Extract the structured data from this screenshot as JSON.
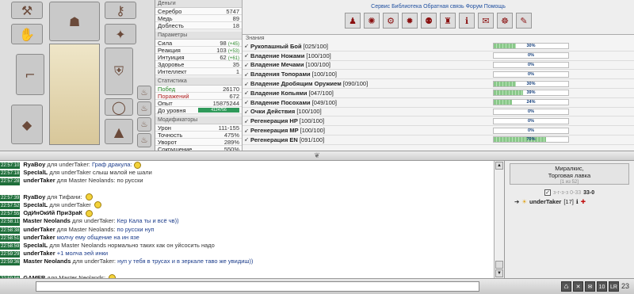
{
  "money": {
    "title": "Деньги",
    "rows": [
      {
        "label": "Серебро",
        "value": "5747"
      },
      {
        "label": "Медь",
        "value": "89"
      },
      {
        "label": "Доблесть",
        "value": "18"
      }
    ]
  },
  "params": {
    "title": "Параметры",
    "rows": [
      {
        "label": "Сила",
        "value": "98",
        "bonus": "(+45)"
      },
      {
        "label": "Реакция",
        "value": "103",
        "bonus": "(+53)"
      },
      {
        "label": "Интуиция",
        "value": "62",
        "bonus": "(+61)"
      },
      {
        "label": "Здоровье",
        "value": "35",
        "bonus": ""
      },
      {
        "label": "Интеллект",
        "value": "1",
        "bonus": ""
      }
    ]
  },
  "statistics": {
    "title": "Статистика",
    "rows": [
      {
        "label": "Побед",
        "value": "26170"
      },
      {
        "label": "Поражений",
        "value": "672"
      },
      {
        "label": "Опыт",
        "value": "15875244"
      },
      {
        "label": "До уровня",
        "value": "4124756"
      }
    ]
  },
  "modifiers": {
    "title": "Модификаторы",
    "rows": [
      {
        "label": "Урон",
        "value": "111-155"
      },
      {
        "label": "Точность",
        "value": "475%"
      },
      {
        "label": "Уворот",
        "value": "289%"
      },
      {
        "label": "Сокрушение",
        "value": "550%"
      }
    ]
  },
  "top_links": "Сервис  Библиотека  Обратная связь  Форум  Помощь",
  "skills": {
    "title": "Знания",
    "items": [
      {
        "name": "Рукопашный Бой",
        "val": "[025/100]",
        "pct": 30,
        "label": "30%"
      },
      {
        "name": "Владение Ножами",
        "val": "[100/100]",
        "pct": 0,
        "label": "0%"
      },
      {
        "name": "Владение Мечами",
        "val": "[100/100]",
        "pct": 0,
        "label": "0%"
      },
      {
        "name": "Владения Топорами",
        "val": "[100/100]",
        "pct": 0,
        "label": "0%"
      },
      {
        "name": "Владение Дробящим Оружием",
        "val": "[090/100]",
        "pct": 30,
        "label": "30%"
      },
      {
        "name": "Владение Копьями",
        "val": "[047/100]",
        "pct": 39,
        "label": "39%"
      },
      {
        "name": "Владение Посохами",
        "val": "[049/100]",
        "pct": 24,
        "label": "24%"
      },
      {
        "name": "Очки Действия",
        "val": "[100/100]",
        "pct": 0,
        "label": "0%"
      },
      {
        "name": "Регенерация HP",
        "val": "[100/100]",
        "pct": 0,
        "label": "0%"
      },
      {
        "name": "Регенерация MP",
        "val": "[100/100]",
        "pct": 0,
        "label": "0%"
      },
      {
        "name": "Регенерация EN",
        "val": "[091/100]",
        "pct": 70,
        "label": "70%"
      }
    ]
  },
  "chat": [
    {
      "t": "22:57:10",
      "nick": "RyaBoy",
      "pm": "для underTaker:",
      "text": "Граф дракула:",
      "emo": true
    },
    {
      "t": "22:57:18",
      "nick": "SpecIalL",
      "pm": "для underTaker слыш малой не шали",
      "text": "",
      "emo": false
    },
    {
      "t": "22:57:28",
      "nick": "underTaker",
      "pm": "для Master Neolands: по русски",
      "text": "",
      "emo": false
    },
    {
      "t": "",
      "nick": "",
      "pm": "",
      "text": "",
      "emo": false
    },
    {
      "t": "22:57:39",
      "nick": "RyaBoy",
      "pm": "для Тифани:",
      "text": "",
      "emo": true
    },
    {
      "t": "22:57:52",
      "nick": "SpecIalL",
      "pm": "для underTaker",
      "text": "",
      "emo": true
    },
    {
      "t": "22:57:55",
      "nick": "ОдИнОкИй ПриЗраК",
      "pm": "",
      "text": "",
      "emo": true
    },
    {
      "t": "22:58:11",
      "nick": "Master Neolands",
      "pm": "для underTaker:",
      "text": "Кер Кала ты и всё чв))",
      "emo": false
    },
    {
      "t": "22:58:38",
      "nick": "underTaker",
      "pm": "для Master Neolands:",
      "text": "по русски нуп",
      "emo": false
    },
    {
      "t": "22:58:51",
      "nick": "underTaker",
      "pm": "",
      "text": "молчу ему общение на ин язе",
      "emo": false
    },
    {
      "t": "22:58:59",
      "nick": "SpecIalL",
      "pm": "для Master Neolands нормально таких как он уйсосить надо",
      "text": "",
      "emo": false
    },
    {
      "t": "22:59:29",
      "nick": "underTaker",
      "pm": "",
      "text": "+1 молча эей инки",
      "emo": false
    },
    {
      "t": "22:59:36",
      "nick": "Master Neolands",
      "pm": "для underTaker:",
      "text": "нуп у тебя в трусах и в зеркале таво же увидиш))",
      "emo": false
    },
    {
      "t": "",
      "nick": "",
      "pm": "",
      "text": "",
      "emo": false
    },
    {
      "t": "22:59:56",
      "nick": "GAMER",
      "pm": "для Master Neolands:",
      "text": "",
      "emo": true
    }
  ],
  "location": {
    "name": "Миралкис,",
    "place": "Торговая лавка",
    "count": "[1 из 52]"
  },
  "online": {
    "checkbox": "✓",
    "dim": "з-г-з-з 0-33",
    "num": "33-0"
  },
  "user": {
    "name": "underTaker",
    "level": "[17]"
  },
  "bottom": {
    "buttons": [
      "♺",
      "✕",
      "✉",
      "10",
      "LR"
    ],
    "number": "23"
  },
  "colors": {
    "timestamp_bg": "#1e6e3a",
    "skill_fill": "#8ac88a",
    "chat_link": "#1a3b8a"
  }
}
